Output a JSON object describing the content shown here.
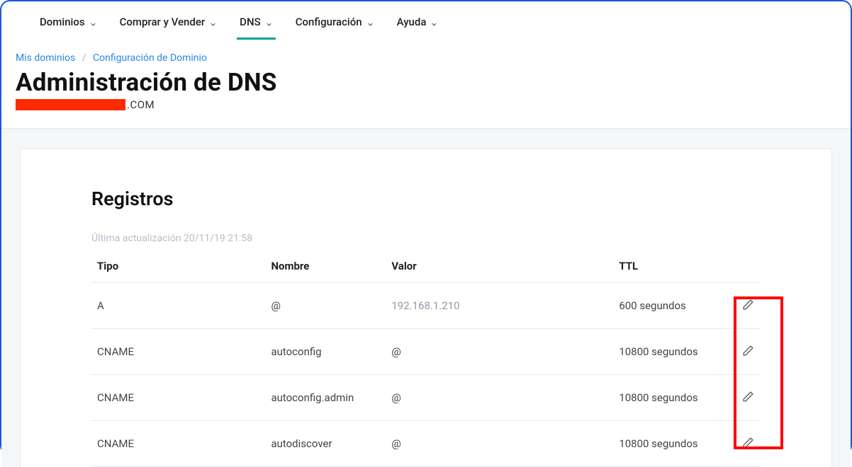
{
  "nav": {
    "items": [
      {
        "label": "Dominios",
        "active": false
      },
      {
        "label": "Comprar y Vender",
        "active": false
      },
      {
        "label": "DNS",
        "active": true
      },
      {
        "label": "Configuración",
        "active": false
      },
      {
        "label": "Ayuda",
        "active": false
      }
    ]
  },
  "breadcrumb": {
    "items": [
      {
        "label": "Mis dominios"
      },
      {
        "label": "Configuración de Dominio"
      }
    ]
  },
  "page": {
    "title": "Administración de DNS",
    "domain_suffix": ".COM"
  },
  "records": {
    "heading": "Registros",
    "last_updated_prefix": "Última actualización",
    "last_updated_value": "20/11/19 21:58",
    "columns": {
      "type": "Tipo",
      "name": "Nombre",
      "value": "Valor",
      "ttl": "TTL"
    },
    "rows": [
      {
        "type": "A",
        "name": "@",
        "value": "192.168.1.210",
        "value_muted": true,
        "ttl": "600 segundos"
      },
      {
        "type": "CNAME",
        "name": "autoconfig",
        "value": "@",
        "value_muted": false,
        "ttl": "10800 segundos"
      },
      {
        "type": "CNAME",
        "name": "autoconfig.admin",
        "value": "@",
        "value_muted": false,
        "ttl": "10800 segundos"
      },
      {
        "type": "CNAME",
        "name": "autodiscover",
        "value": "@",
        "value_muted": false,
        "ttl": "10800 segundos"
      }
    ]
  }
}
